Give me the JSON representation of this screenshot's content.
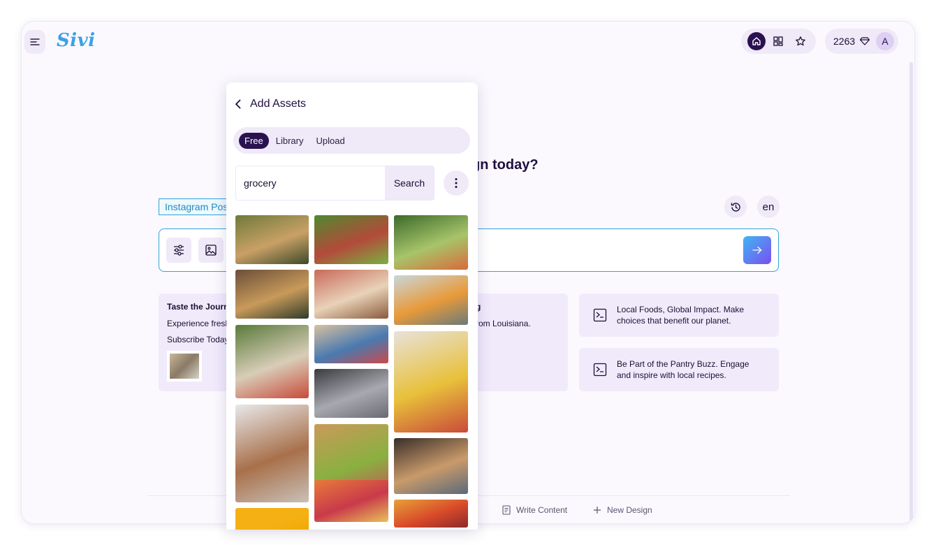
{
  "app": {
    "logo": "Sivi"
  },
  "header": {
    "nav": {
      "home": "home-icon",
      "templates": "grid-icon",
      "favorites": "star-icon"
    },
    "credits": "2263",
    "avatar_initial": "A"
  },
  "main": {
    "heading": "want to design today?",
    "format_tag": "Instagram Post",
    "language": "en",
    "history_icon": "history-icon"
  },
  "cards": {
    "card1_title": "Taste the Journey",
    "card1_line1": "Experience fresh",
    "card1_line2": "Subscribe Today",
    "card2_title": "g",
    "card2_line1": "rom Louisiana.",
    "suggestion1": "Local Foods, Global Impact. Make choices that benefit our planet.",
    "suggestion2": "Be Part of the Pantry Buzz. Engage and inspire with local recipes."
  },
  "footer": {
    "write_content": "Write Content",
    "new_design": "New Design"
  },
  "panel": {
    "title": "Add Assets",
    "tabs": [
      "Free",
      "Library",
      "Upload"
    ],
    "active_tab": "Free",
    "search_value": "grocery",
    "search_button": "Search",
    "images": [
      {
        "name": "produce-aisle",
        "colors": [
          "#6e7a3a",
          "#c9a066",
          "#3d4a2a"
        ]
      },
      {
        "name": "leafy-greens",
        "colors": [
          "#4f8a2e",
          "#b34a3a",
          "#7ab043"
        ]
      },
      {
        "name": "vegetable-shelves",
        "colors": [
          "#3c6a2a",
          "#a7c46a",
          "#d96b3a"
        ]
      },
      {
        "name": "store-aisle",
        "colors": [
          "#6b4e3a",
          "#c89a5a",
          "#2f3a2a"
        ]
      },
      {
        "name": "apples-bag",
        "colors": [
          "#c96a5a",
          "#e8d2b8",
          "#8a5a3a"
        ]
      },
      {
        "name": "shopper-woman",
        "colors": [
          "#c9d6da",
          "#e89a3a",
          "#6a7a7a"
        ]
      },
      {
        "name": "cart-vegetables",
        "colors": [
          "#5a7a3a",
          "#d8cdb8",
          "#c84a3a"
        ]
      },
      {
        "name": "packaged-goods",
        "colors": [
          "#d8c0a0",
          "#4a7ab0",
          "#c94a4a"
        ]
      },
      {
        "name": "bananas-bag",
        "colors": [
          "#e8e2da",
          "#e8c03a",
          "#c94a3a"
        ]
      },
      {
        "name": "paper-bag",
        "colors": [
          "#e8e8ea",
          "#a8704a",
          "#c9c0b8"
        ]
      },
      {
        "name": "shopping-carts",
        "colors": [
          "#3a3a40",
          "#a8a8b0",
          "#6a6a72"
        ]
      },
      {
        "name": "store-shelves",
        "colors": [
          "#3a2e2a",
          "#c99a6a",
          "#5a6a7a"
        ]
      },
      {
        "name": "grocery-box",
        "colors": [
          "#c99a5a",
          "#8ab040",
          "#c94a5a"
        ]
      },
      {
        "name": "fruit-stand",
        "colors": [
          "#e87a3a",
          "#c93a4a",
          "#e8c05a"
        ]
      },
      {
        "name": "citrus-pile",
        "colors": [
          "#e8a03a",
          "#d84a2a",
          "#8a2a2a"
        ]
      },
      {
        "name": "yellow-card",
        "colors": [
          "#f5b014",
          "#f5b014",
          "#f0a800"
        ]
      }
    ]
  },
  "colors": {
    "accent_dark": "#2a1250",
    "accent_blue": "#2ea6d6",
    "panel_bg": "#efe9f8"
  }
}
